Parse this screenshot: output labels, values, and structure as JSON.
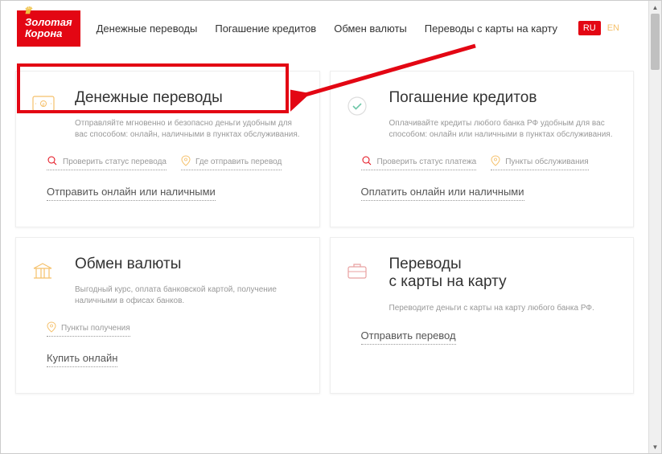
{
  "logo": {
    "line1": "Золотая",
    "line2": "Корона"
  },
  "nav": {
    "transfers": "Денежные переводы",
    "credits": "Погашение кредитов",
    "exchange": "Обмен валюты",
    "card2card": "Переводы с карты на карту"
  },
  "lang": {
    "ru": "RU",
    "en": "EN"
  },
  "cards": {
    "transfers": {
      "title": "Денежные переводы",
      "desc": "Отправляйте мгновенно и безопасно деньги удобным для вас способом: онлайн, наличными в пунктах обслуживания.",
      "link1": "Проверить статус перевода",
      "link2": "Где отправить перевод",
      "action": "Отправить онлайн или наличными"
    },
    "credits": {
      "title": "Погашение кредитов",
      "desc": "Оплачивайте кредиты любого банка РФ удобным для вас способом: онлайн или наличными в пунктах обслуживания.",
      "link1": "Проверить статус платежа",
      "link2": "Пункты обслуживания",
      "action": "Оплатить онлайн или наличными"
    },
    "exchange": {
      "title": "Обмен валюты",
      "desc": "Выгодный курс, оплата банковской картой, получение наличными в офисах банков.",
      "link1": "Пункты получения",
      "action": "Купить онлайн"
    },
    "card2card": {
      "title_line1": "Переводы",
      "title_line2": "с карты на карту",
      "desc": "Переводите деньги с карты на карту любого банка РФ.",
      "action": "Отправить перевод"
    }
  }
}
